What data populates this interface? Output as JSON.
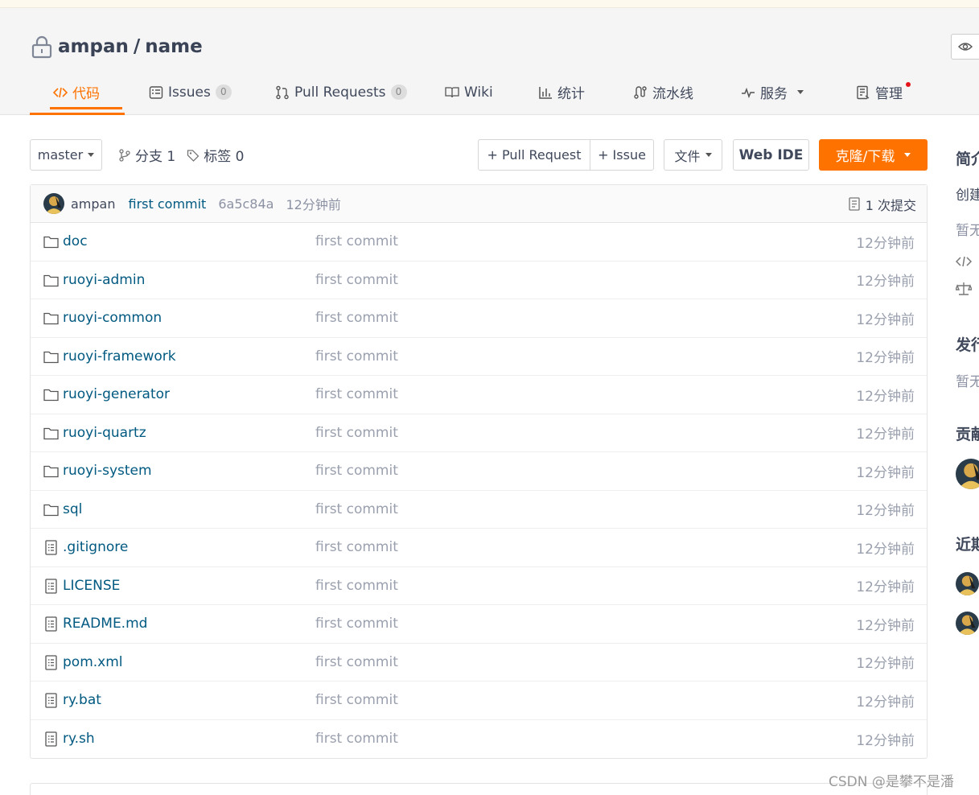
{
  "repo": {
    "owner": "ampan",
    "separator": "/",
    "name": "name"
  },
  "tabs": [
    {
      "label": "代码",
      "icon": "code-icon"
    },
    {
      "label": "Issues",
      "count": "0",
      "icon": "issues-icon"
    },
    {
      "label": "Pull Requests",
      "count": "0",
      "icon": "pull-request-icon"
    },
    {
      "label": "Wiki",
      "icon": "book-icon"
    },
    {
      "label": "统计",
      "icon": "bar-chart-icon"
    },
    {
      "label": "流水线",
      "icon": "pipeline-icon"
    },
    {
      "label": "服务",
      "icon": "pulse-icon"
    },
    {
      "label": "管理",
      "icon": "manage-icon"
    }
  ],
  "toolbar": {
    "branch": "master",
    "branches_label": "分支 1",
    "tags_label": "标签 0",
    "pull_request_btn": "+ Pull Request",
    "issue_btn": "+ Issue",
    "file_btn": "文件",
    "web_ide_btn": "Web IDE",
    "clone_btn": "克隆/下载"
  },
  "commit": {
    "author": "ampan",
    "message": "first commit",
    "sha": "6a5c84a",
    "time": "12分钟前",
    "count_label": "1 次提交"
  },
  "files": [
    {
      "type": "folder",
      "name": "doc",
      "message": "first commit",
      "time": "12分钟前"
    },
    {
      "type": "folder",
      "name": "ruoyi-admin",
      "message": "first commit",
      "time": "12分钟前"
    },
    {
      "type": "folder",
      "name": "ruoyi-common",
      "message": "first commit",
      "time": "12分钟前"
    },
    {
      "type": "folder",
      "name": "ruoyi-framework",
      "message": "first commit",
      "time": "12分钟前"
    },
    {
      "type": "folder",
      "name": "ruoyi-generator",
      "message": "first commit",
      "time": "12分钟前"
    },
    {
      "type": "folder",
      "name": "ruoyi-quartz",
      "message": "first commit",
      "time": "12分钟前"
    },
    {
      "type": "folder",
      "name": "ruoyi-system",
      "message": "first commit",
      "time": "12分钟前"
    },
    {
      "type": "folder",
      "name": "sql",
      "message": "first commit",
      "time": "12分钟前"
    },
    {
      "type": "file",
      "name": ".gitignore",
      "message": "first commit",
      "time": "12分钟前"
    },
    {
      "type": "file",
      "name": "LICENSE",
      "message": "first commit",
      "time": "12分钟前"
    },
    {
      "type": "file",
      "name": "README.md",
      "message": "first commit",
      "time": "12分钟前"
    },
    {
      "type": "file",
      "name": "pom.xml",
      "message": "first commit",
      "time": "12分钟前"
    },
    {
      "type": "file",
      "name": "ry.bat",
      "message": "first commit",
      "time": "12分钟前"
    },
    {
      "type": "file",
      "name": "ry.sh",
      "message": "first commit",
      "time": "12分钟前"
    }
  ],
  "sidebar": {
    "intro_heading": "简介",
    "intro_line1": "创建",
    "intro_line2": "暂无",
    "release_heading": "发行",
    "release_text": "暂无",
    "contrib_heading": "贡献",
    "recent_heading": "近期"
  },
  "watermark": "CSDN @是攀不是潘",
  "colors": {
    "accent": "#fe7300",
    "link": "#005980",
    "muted": "#9aa0ae",
    "badge_red": "#e5141a"
  }
}
